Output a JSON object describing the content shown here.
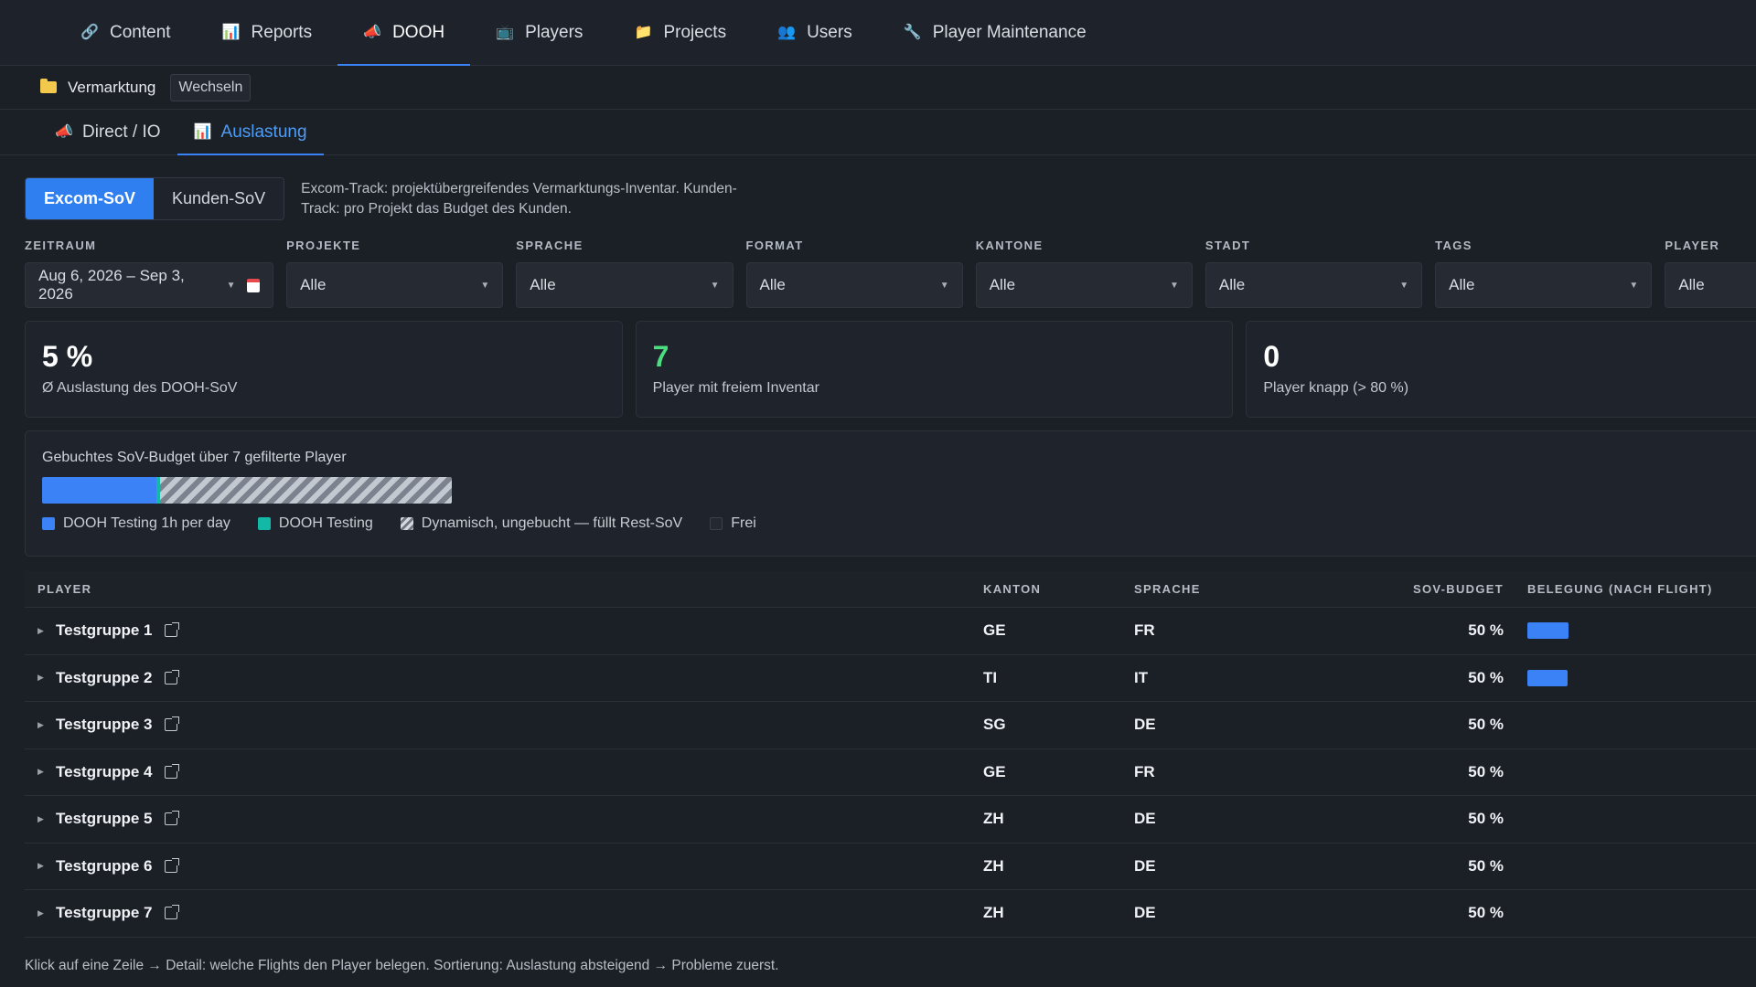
{
  "topnav": {
    "tabs": [
      {
        "label": "Content",
        "icon": "link-icon",
        "active": false
      },
      {
        "label": "Reports",
        "icon": "bar-chart-icon",
        "active": false
      },
      {
        "label": "DOOH",
        "icon": "megaphone-icon",
        "active": true
      },
      {
        "label": "Players",
        "icon": "tv-icon",
        "active": false
      },
      {
        "label": "Projects",
        "icon": "folder-icon",
        "active": false
      },
      {
        "label": "Users",
        "icon": "users-icon",
        "active": false
      },
      {
        "label": "Player Maintenance",
        "icon": "wrench-icon",
        "active": false
      }
    ]
  },
  "context": {
    "name": "Vermarktung",
    "switch_label": "Wechseln"
  },
  "subtabs": [
    {
      "label": "Direct / IO",
      "icon": "megaphone-icon",
      "active": false
    },
    {
      "label": "Auslastung",
      "icon": "bar-chart-icon",
      "active": true
    }
  ],
  "segment": {
    "options": [
      "Excom-SoV",
      "Kunden-SoV"
    ],
    "selected": "Excom-SoV",
    "description": "Excom-Track: projektübergreifendes Vermarktungs-Inventar. Kunden-Track: pro Projekt das Budget des Kunden."
  },
  "filters": {
    "zeitraum": {
      "label": "ZEITRAUM",
      "value": "Aug 6, 2026 – Sep 3, 2026"
    },
    "projekte": {
      "label": "PROJEKTE",
      "value": "Alle"
    },
    "sprache": {
      "label": "SPRACHE",
      "value": "Alle"
    },
    "format": {
      "label": "FORMAT",
      "value": "Alle"
    },
    "kantone": {
      "label": "KANTONE",
      "value": "Alle"
    },
    "stadt": {
      "label": "STADT",
      "value": "Alle"
    },
    "tags": {
      "label": "TAGS",
      "value": "Alle"
    },
    "player": {
      "label": "PLAYER",
      "value": "Alle"
    }
  },
  "kpis": [
    {
      "value": "5 %",
      "label": "Ø Auslastung des DOOH-SoV",
      "accent": "#ffffff"
    },
    {
      "value": "7",
      "label": "Player mit freiem Inventar",
      "accent": "#4ade80"
    },
    {
      "value": "0",
      "label": "Player knapp (> 80 %)",
      "accent": "#ffffff"
    }
  ],
  "budget": {
    "title": "Gebuchtes SoV-Budget über 7 gefilterte Player",
    "share_dooh_testing_1h": 0.28,
    "share_dooh_testing": 0.01,
    "share_dynamic": 0.71,
    "legend": [
      {
        "label": "DOOH Testing 1h per day",
        "color": "#3b82f6"
      },
      {
        "label": "DOOH Testing",
        "color": "#14b8a6"
      },
      {
        "label": "Dynamisch, ungebucht — füllt Rest-SoV",
        "color": "hatched"
      },
      {
        "label": "Frei",
        "color": "#232831"
      }
    ]
  },
  "table": {
    "headers": {
      "player": "PLAYER",
      "kanton": "KANTON",
      "sprache": "SPRACHE",
      "budget": "SOV-BUDGET",
      "belegung": "BELEGUNG (NACH FLIGHT)"
    },
    "rows": [
      {
        "player": "Testgruppe 1",
        "kanton": "GE",
        "sprache": "FR",
        "budget": "50 %",
        "occupancy": 0.18
      },
      {
        "player": "Testgruppe 2",
        "kanton": "TI",
        "sprache": "IT",
        "budget": "50 %",
        "occupancy": 0.175
      },
      {
        "player": "Testgruppe 3",
        "kanton": "SG",
        "sprache": "DE",
        "budget": "50 %",
        "occupancy": 0
      },
      {
        "player": "Testgruppe 4",
        "kanton": "GE",
        "sprache": "FR",
        "budget": "50 %",
        "occupancy": 0
      },
      {
        "player": "Testgruppe 5",
        "kanton": "ZH",
        "sprache": "DE",
        "budget": "50 %",
        "occupancy": 0
      },
      {
        "player": "Testgruppe 6",
        "kanton": "ZH",
        "sprache": "DE",
        "budget": "50 %",
        "occupancy": 0
      },
      {
        "player": "Testgruppe 7",
        "kanton": "ZH",
        "sprache": "DE",
        "budget": "50 %",
        "occupancy": 0
      }
    ]
  },
  "footer": "Klick auf eine Zeile → Detail: welche Flights den Player belegen. Sortierung: Auslastung absteigend → Probleme zuerst."
}
